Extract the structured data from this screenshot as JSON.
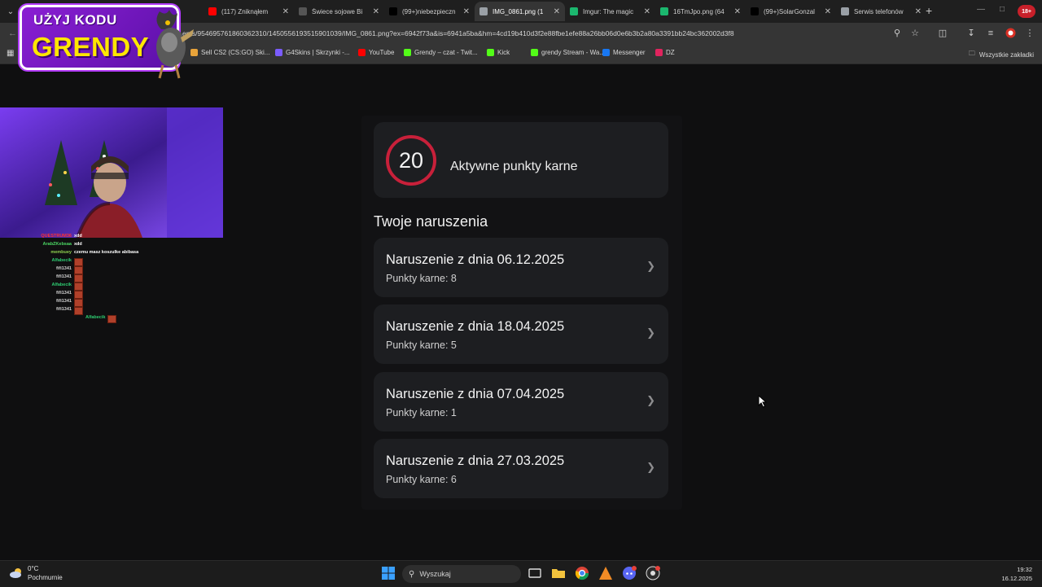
{
  "browser": {
    "tabs": [
      {
        "label": "(117) Zniknąłem",
        "icon": "youtube-icon",
        "color": "#ff0000",
        "active": false
      },
      {
        "label": "Świece sojowe Bi",
        "icon": "site-icon",
        "color": "#555555",
        "active": false
      },
      {
        "label": "(99+)niebezpieczn",
        "icon": "tiktok-icon",
        "color": "#000000",
        "active": false
      },
      {
        "label": "IMG_0861.png (1",
        "icon": "globe-icon",
        "color": "#9aa0a6",
        "active": true
      },
      {
        "label": "Imgur: The magic",
        "icon": "imgur-icon",
        "color": "#1bb76e",
        "active": false
      },
      {
        "label": "16TmJpo.png (64",
        "icon": "imgur-icon",
        "color": "#1bb76e",
        "active": false
      },
      {
        "label": "(99+)SolarGonzal",
        "icon": "tiktok-icon",
        "color": "#000000",
        "active": false
      },
      {
        "label": "Serwis telefonów",
        "icon": "globe-icon",
        "color": "#9aa0a6",
        "active": false
      }
    ],
    "new_tab": "+",
    "url": "ents/954695761860362310/1450556193515901039/IMG_0861.png?ex=6942f73a&is=6941a5ba&hm=4cd19b410d3f2e88fbe1efe88a26bb06d0e6b3b2a80a3391bb24bc362002d3f8",
    "profile_badge": "18+",
    "bookmarks": [
      {
        "label": "Sell CS2 (CS:GO) Ski...",
        "color": "#e8a33a"
      },
      {
        "label": "G4Skins | Skrzynki -...",
        "color": "#7b5cff"
      },
      {
        "label": "YouTube",
        "color": "#ff0000"
      },
      {
        "label": "Grendy – czat - Twit...",
        "color": "#53fc18"
      },
      {
        "label": "Kick",
        "color": "#53fc18"
      },
      {
        "label": "grendy Stream - Wa...",
        "color": "#53fc18"
      },
      {
        "label": "Messenger",
        "color": "#1877f2"
      },
      {
        "label": "DZ",
        "color": "#e0245e"
      }
    ],
    "all_bookmarks": "Wszystkie zakładki"
  },
  "promo": {
    "line1": "UŻYJ KODU",
    "line2": "GRENDY"
  },
  "chat": [
    {
      "name": "QUESTRUM36",
      "msg": "xdd",
      "color": "#ff3030"
    },
    {
      "name": "ArabZKebsaa",
      "msg": "xdd",
      "color": "#4cd964"
    },
    {
      "name": "membuey",
      "msg": "czemu masz koszulke abibasa",
      "color": "#8fd14f"
    },
    {
      "name": "Alfabecik",
      "msg": "",
      "color": "#2ecc71"
    },
    {
      "name": "fifi1341",
      "msg": "",
      "color": "#d0d0d0"
    },
    {
      "name": "fifi1341",
      "msg": "",
      "color": "#d0d0d0"
    },
    {
      "name": "Alfabecik",
      "msg": "",
      "color": "#2ecc71"
    },
    {
      "name": "fifi1341",
      "msg": "",
      "color": "#d0d0d0"
    },
    {
      "name": "fifi1341",
      "msg": "",
      "color": "#d0d0d0"
    },
    {
      "name": "fifi1341",
      "msg": "",
      "color": "#d0d0d0"
    },
    {
      "name": "Alfabecik",
      "msg": "",
      "color": "#2ecc71"
    }
  ],
  "app": {
    "active_points": "20",
    "active_points_label": "Aktywne punkty karne",
    "ring_color": "#c8203a",
    "section_title": "Twoje naruszenia",
    "violations": [
      {
        "title": "Naruszenie z dnia 06.12.2025",
        "points": "Punkty karne: 8"
      },
      {
        "title": "Naruszenie z dnia 18.04.2025",
        "points": "Punkty karne: 5"
      },
      {
        "title": "Naruszenie z dnia 07.04.2025",
        "points": "Punkty karne: 1"
      },
      {
        "title": "Naruszenie z dnia 27.03.2025",
        "points": "Punkty karne: 6"
      }
    ]
  },
  "taskbar": {
    "temperature": "0°C",
    "weather": "Pochmurnie",
    "search_placeholder": "Wyszukaj",
    "time": "19:32",
    "date": "16.12.2025"
  }
}
